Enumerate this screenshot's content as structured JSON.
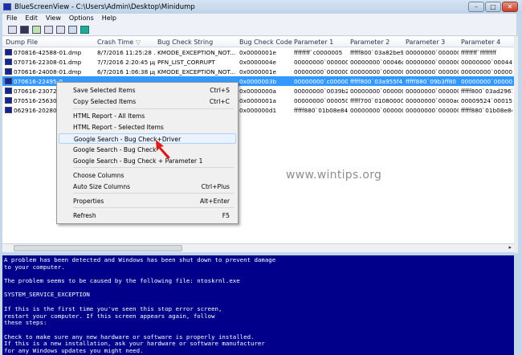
{
  "window": {
    "title": "BlueScreenView  -  C:\\Users\\Admin\\Desktop\\Minidump",
    "minimize": "–",
    "maximize": "□",
    "close": "✕"
  },
  "menubar": [
    "File",
    "Edit",
    "View",
    "Options",
    "Help"
  ],
  "toolbar": [
    "properties-icon",
    "save-icon",
    "refresh-icon",
    "copy-icon",
    "options-icon",
    "find-icon",
    "exit-icon"
  ],
  "columns": [
    "Dump File",
    "Crash Time",
    "Bug Check String",
    "Bug Check Code",
    "Parameter 1",
    "Parameter 2",
    "Parameter 3",
    "Parameter 4"
  ],
  "sort_indicator": "▽",
  "rows": [
    [
      "070816-42588-01.dmp",
      "8/7/2016 11:25:28 ...",
      "KMODE_EXCEPTION_NOT...",
      "0x0000001e",
      "ffffffff`c0000005",
      "fffff800`03a82be9",
      "00000000`000000...",
      "ffffffff`ffffffff"
    ],
    [
      "070716-22308-01.dmp",
      "7/7/2016 2:20:45 μμ",
      "PFN_LIST_CORRUPT",
      "0x0000004e",
      "00000000`000000...",
      "00000000`00046d7f",
      "00000000`000000...",
      "00000000`00044ffe"
    ],
    [
      "070616-24008-01.dmp",
      "6/7/2016 1:06:38 μμ",
      "KMODE_EXCEPTION_NOT...",
      "0x0000001e",
      "00000000`000000...",
      "00000000`000000...",
      "00000000`000000...",
      "00000000`000000..."
    ],
    [
      "070616-22495-0",
      "",
      "",
      "0x0000003b",
      "00000000`c00000...",
      "fffff800`03a955f4",
      "fffff880`09b3ff80",
      "00000000`000000..."
    ],
    [
      "070616-23072-0",
      "",
      "",
      "0x0000000a",
      "00000000`0039b2...",
      "00000000`000000...",
      "00000000`000000...",
      "fffff800`03ad2961"
    ],
    [
      "070516-25630-0",
      "",
      "",
      "0x0000001a",
      "00000000`000050...",
      "fffff700`01080000",
      "00000000`0000ad...",
      "00009524`000153..."
    ],
    [
      "062916-20280-0",
      "",
      "",
      "0x000000d1",
      "fffff880`01b08e84",
      "00000000`000000...",
      "00000000`000000...",
      "fffff880`01b08e84"
    ]
  ],
  "context_menu": [
    {
      "label": "Save Selected Items",
      "shortcut": "Ctrl+S"
    },
    {
      "label": "Copy Selected Items",
      "shortcut": "Ctrl+C"
    },
    {
      "label": "HTML Report - All Items",
      "shortcut": ""
    },
    {
      "label": "HTML Report - Selected Items",
      "shortcut": ""
    },
    {
      "label": "Google Search - Bug Check+Driver",
      "shortcut": ""
    },
    {
      "label": "Google Search - Bug Check",
      "shortcut": ""
    },
    {
      "label": "Google Search - Bug Check + Parameter 1",
      "shortcut": ""
    },
    {
      "label": "Choose Columns",
      "shortcut": ""
    },
    {
      "label": "Auto Size Columns",
      "shortcut": "Ctrl+Plus"
    },
    {
      "label": "Properties",
      "shortcut": "Alt+Enter"
    },
    {
      "label": "Refresh",
      "shortcut": "F5"
    }
  ],
  "watermark": "www.wintips.org",
  "bsod": [
    "A problem has been detected and Windows has been shut down to prevent damage",
    "to your computer.",
    "",
    "The problem seems to be caused by the following file: ntoskrnl.exe",
    "",
    "SYSTEM_SERVICE_EXCEPTION",
    "",
    "If this is the first time you've seen this stop error screen,",
    "restart your computer. If this screen appears again, follow",
    "these steps:",
    "",
    "Check to make sure any new hardware or software is properly installed.",
    "If this is a new installation, ask your hardware or software manufacturer",
    "for any Windows updates you might need."
  ],
  "colors": {
    "selection": "#3399ff",
    "bsod": "#00008a"
  }
}
